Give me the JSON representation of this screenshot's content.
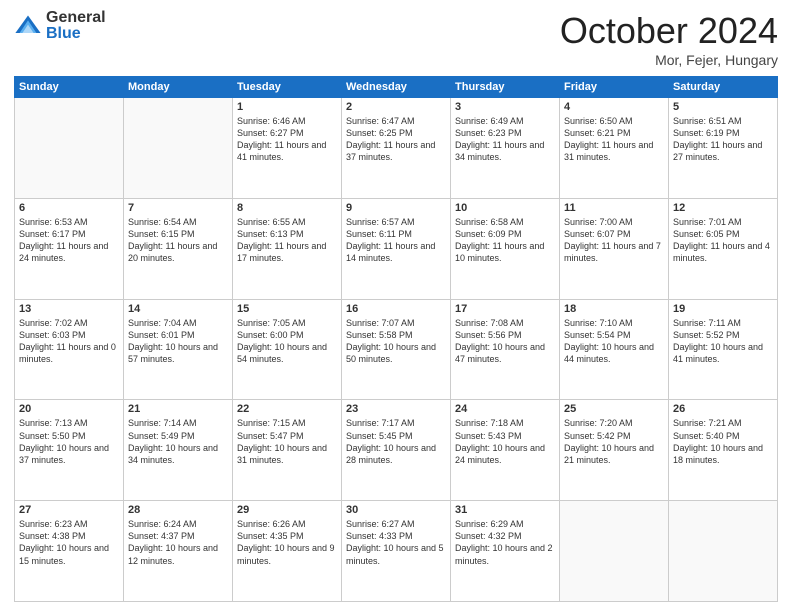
{
  "logo": {
    "general": "General",
    "blue": "Blue"
  },
  "header": {
    "month": "October 2024",
    "location": "Mor, Fejer, Hungary"
  },
  "weekdays": [
    "Sunday",
    "Monday",
    "Tuesday",
    "Wednesday",
    "Thursday",
    "Friday",
    "Saturday"
  ],
  "weeks": [
    [
      {
        "day": "",
        "info": ""
      },
      {
        "day": "",
        "info": ""
      },
      {
        "day": "1",
        "info": "Sunrise: 6:46 AM\nSunset: 6:27 PM\nDaylight: 11 hours and 41 minutes."
      },
      {
        "day": "2",
        "info": "Sunrise: 6:47 AM\nSunset: 6:25 PM\nDaylight: 11 hours and 37 minutes."
      },
      {
        "day": "3",
        "info": "Sunrise: 6:49 AM\nSunset: 6:23 PM\nDaylight: 11 hours and 34 minutes."
      },
      {
        "day": "4",
        "info": "Sunrise: 6:50 AM\nSunset: 6:21 PM\nDaylight: 11 hours and 31 minutes."
      },
      {
        "day": "5",
        "info": "Sunrise: 6:51 AM\nSunset: 6:19 PM\nDaylight: 11 hours and 27 minutes."
      }
    ],
    [
      {
        "day": "6",
        "info": "Sunrise: 6:53 AM\nSunset: 6:17 PM\nDaylight: 11 hours and 24 minutes."
      },
      {
        "day": "7",
        "info": "Sunrise: 6:54 AM\nSunset: 6:15 PM\nDaylight: 11 hours and 20 minutes."
      },
      {
        "day": "8",
        "info": "Sunrise: 6:55 AM\nSunset: 6:13 PM\nDaylight: 11 hours and 17 minutes."
      },
      {
        "day": "9",
        "info": "Sunrise: 6:57 AM\nSunset: 6:11 PM\nDaylight: 11 hours and 14 minutes."
      },
      {
        "day": "10",
        "info": "Sunrise: 6:58 AM\nSunset: 6:09 PM\nDaylight: 11 hours and 10 minutes."
      },
      {
        "day": "11",
        "info": "Sunrise: 7:00 AM\nSunset: 6:07 PM\nDaylight: 11 hours and 7 minutes."
      },
      {
        "day": "12",
        "info": "Sunrise: 7:01 AM\nSunset: 6:05 PM\nDaylight: 11 hours and 4 minutes."
      }
    ],
    [
      {
        "day": "13",
        "info": "Sunrise: 7:02 AM\nSunset: 6:03 PM\nDaylight: 11 hours and 0 minutes."
      },
      {
        "day": "14",
        "info": "Sunrise: 7:04 AM\nSunset: 6:01 PM\nDaylight: 10 hours and 57 minutes."
      },
      {
        "day": "15",
        "info": "Sunrise: 7:05 AM\nSunset: 6:00 PM\nDaylight: 10 hours and 54 minutes."
      },
      {
        "day": "16",
        "info": "Sunrise: 7:07 AM\nSunset: 5:58 PM\nDaylight: 10 hours and 50 minutes."
      },
      {
        "day": "17",
        "info": "Sunrise: 7:08 AM\nSunset: 5:56 PM\nDaylight: 10 hours and 47 minutes."
      },
      {
        "day": "18",
        "info": "Sunrise: 7:10 AM\nSunset: 5:54 PM\nDaylight: 10 hours and 44 minutes."
      },
      {
        "day": "19",
        "info": "Sunrise: 7:11 AM\nSunset: 5:52 PM\nDaylight: 10 hours and 41 minutes."
      }
    ],
    [
      {
        "day": "20",
        "info": "Sunrise: 7:13 AM\nSunset: 5:50 PM\nDaylight: 10 hours and 37 minutes."
      },
      {
        "day": "21",
        "info": "Sunrise: 7:14 AM\nSunset: 5:49 PM\nDaylight: 10 hours and 34 minutes."
      },
      {
        "day": "22",
        "info": "Sunrise: 7:15 AM\nSunset: 5:47 PM\nDaylight: 10 hours and 31 minutes."
      },
      {
        "day": "23",
        "info": "Sunrise: 7:17 AM\nSunset: 5:45 PM\nDaylight: 10 hours and 28 minutes."
      },
      {
        "day": "24",
        "info": "Sunrise: 7:18 AM\nSunset: 5:43 PM\nDaylight: 10 hours and 24 minutes."
      },
      {
        "day": "25",
        "info": "Sunrise: 7:20 AM\nSunset: 5:42 PM\nDaylight: 10 hours and 21 minutes."
      },
      {
        "day": "26",
        "info": "Sunrise: 7:21 AM\nSunset: 5:40 PM\nDaylight: 10 hours and 18 minutes."
      }
    ],
    [
      {
        "day": "27",
        "info": "Sunrise: 6:23 AM\nSunset: 4:38 PM\nDaylight: 10 hours and 15 minutes."
      },
      {
        "day": "28",
        "info": "Sunrise: 6:24 AM\nSunset: 4:37 PM\nDaylight: 10 hours and 12 minutes."
      },
      {
        "day": "29",
        "info": "Sunrise: 6:26 AM\nSunset: 4:35 PM\nDaylight: 10 hours and 9 minutes."
      },
      {
        "day": "30",
        "info": "Sunrise: 6:27 AM\nSunset: 4:33 PM\nDaylight: 10 hours and 5 minutes."
      },
      {
        "day": "31",
        "info": "Sunrise: 6:29 AM\nSunset: 4:32 PM\nDaylight: 10 hours and 2 minutes."
      },
      {
        "day": "",
        "info": ""
      },
      {
        "day": "",
        "info": ""
      }
    ]
  ]
}
